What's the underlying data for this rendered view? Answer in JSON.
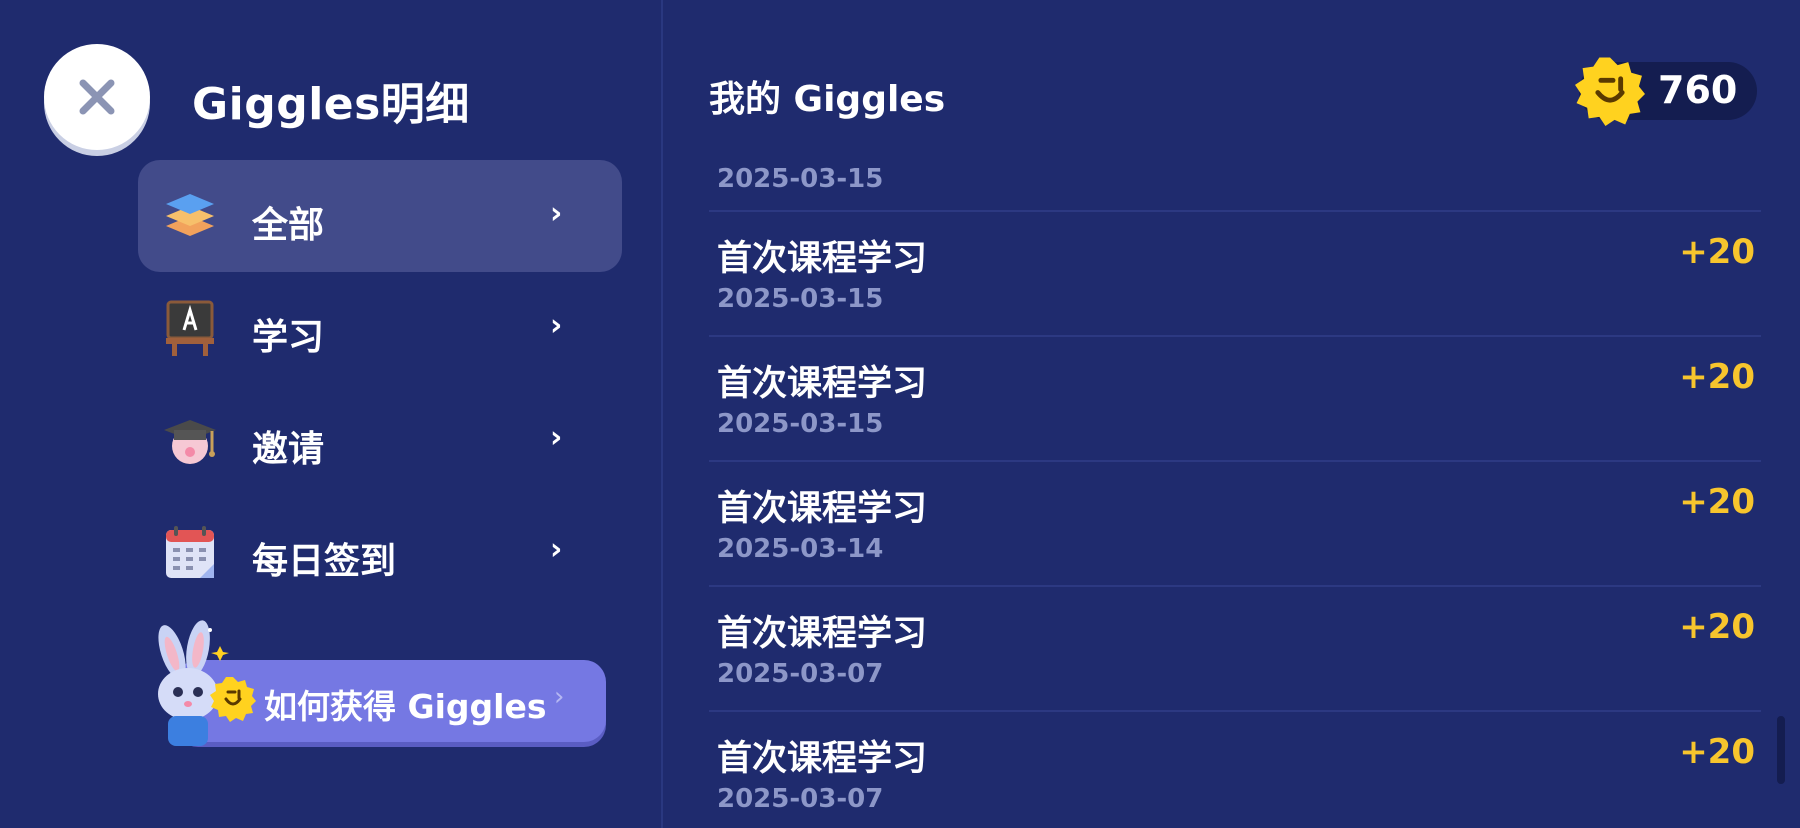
{
  "header": {
    "title": "Giggles明细"
  },
  "sidebar": {
    "items": [
      {
        "label": "全部",
        "icon": "layers-icon",
        "active": true
      },
      {
        "label": "学习",
        "icon": "blackboard-icon",
        "active": false
      },
      {
        "label": "邀请",
        "icon": "graduate-icon",
        "active": false
      },
      {
        "label": "每日签到",
        "icon": "calendar-icon",
        "active": false
      }
    ],
    "how_to_label": "如何获得 Giggles"
  },
  "main": {
    "title": "我的 Giggles",
    "balance": "760",
    "first_date": "2025-03-15",
    "records": [
      {
        "title": "首次课程学习",
        "date": "2025-03-15",
        "points": "+20"
      },
      {
        "title": "首次课程学习",
        "date": "2025-03-15",
        "points": "+20"
      },
      {
        "title": "首次课程学习",
        "date": "2025-03-14",
        "points": "+20"
      },
      {
        "title": "首次课程学习",
        "date": "2025-03-07",
        "points": "+20"
      },
      {
        "title": "首次课程学习",
        "date": "2025-03-07",
        "points": "+20"
      }
    ]
  },
  "colors": {
    "background": "#1f2b6e",
    "active_item": "#424b8a",
    "points": "#f7c52d",
    "date_text": "#8d97c8",
    "how_button": "#7578e3",
    "coin": "#ffd21f"
  }
}
